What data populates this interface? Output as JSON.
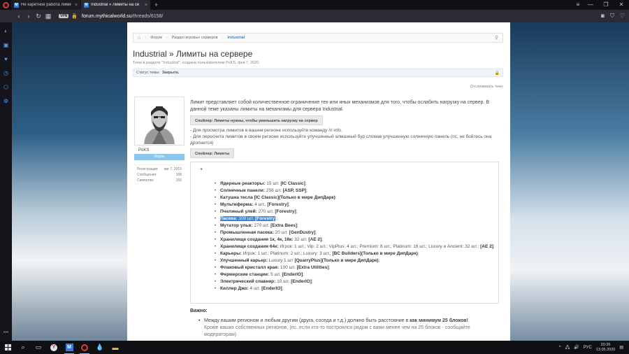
{
  "browser": {
    "tabs": [
      {
        "label": "Не каретное работа лими",
        "active": false
      },
      {
        "label": "Industrial » Лимиты на се",
        "active": true
      }
    ],
    "url_host": "forum.mythicalworld.su",
    "url_path": "/threads/6158/",
    "vpn_label": "VPN"
  },
  "breadcrumb": {
    "items": [
      "Форум",
      "Раздел игровых серверов",
      "Industrial"
    ]
  },
  "thread": {
    "title": "Industrial » Лимиты на сервере",
    "subtitle": "Тема в разделе \"Industrial\", создана пользователем PoKS, фев 7, 2020.",
    "status_label": "Статус темы:",
    "status_value": "Закрыта.",
    "watch_label": "Отслеживать тему"
  },
  "author": {
    "username": "PoKS",
    "role": "Игрок",
    "stats": [
      {
        "k": "Регистрация:",
        "v": "авг 7, 2015"
      },
      {
        "k": "Сообщения:",
        "v": "168"
      },
      {
        "k": "Симпатии:",
        "v": "155"
      }
    ]
  },
  "post": {
    "intro": "Лимит представляет собой количественное ограничение тех или иных механизмов для того, чтобы ослабить нагрузку на сервер. В данной теме указаны лимиты на механизмы для сервера Industrial.",
    "spoiler1": "Спойлер: Лимиты нужны, чтобы уменьшить нагрузку на сервер",
    "note1": "- Для просмотра лимитов в вашем регионе используйте команду /rl info.",
    "note2": "- Для пересчета лимитов в своем регионе используйте улучшенный алмазный бур сломав улучшенную солнечную панель (пс, не бойтесь она дропнется)",
    "spoiler2": "Спойлер: Лимиты",
    "limits": [
      {
        "name": "Ядерные реакторы:",
        "val": " 15 шт. ",
        "tag": "[IC Classic]",
        "end": ";"
      },
      {
        "name": "Солнечные панели:",
        "val": " 256 шт. ",
        "tag": "[ASP, SSP]",
        "end": ";"
      },
      {
        "name": "Катушка тесла [IC Classic](Только в мире ДипДарк)",
        "val": "",
        "tag": "",
        "end": ":"
      },
      {
        "name": "Мультиферма:",
        "val": " 4 шт., ",
        "tag": "[Forestry]",
        "end": ";"
      },
      {
        "name": "Пчелиный улей:",
        "val": " 270 шт. ",
        "tag": "[Forestry]",
        "end": ";"
      },
      {
        "name": "Пасека:",
        "val": " 100 шт. ",
        "tag": "[Forestry]",
        "end": ";",
        "highlight": true
      },
      {
        "name": "Мутатор ульв:",
        "val": " 270 шт. ",
        "tag": "[Extra Bees]",
        "end": ";"
      },
      {
        "name": "Промышленная пасека:",
        "val": " 20 шт. ",
        "tag": "[GenDustry]",
        "end": ";"
      },
      {
        "name": "Хранилище создания 1к, 4к, 16к:",
        "val": " 32 шт. ",
        "tag": "[AE 2]",
        "end": ";"
      },
      {
        "name": "Хранилище создания 64к:",
        "val": " Игрок: 1 шт.; Vip: 2 шт.; VipPlus: 4 шт.; Premium: 8 шт.; Platinum: 16 шт.; Luxury и Ancient: 32 шт.; ",
        "tag": "[AE 2]",
        "end": ";"
      },
      {
        "name": "Карьеры:",
        "val": " Игрок: 1 шт.; Platinum: 2 шт.; Luxury: 3 шт.; ",
        "tag": "[BC Builders](Только в мире ДипДарк)",
        "end": ";"
      },
      {
        "name": "Улучшенный карьер:",
        "val": " Luxury:1 шт ",
        "tag": "[QuarryPlus](Только в мире ДипДарк)",
        "end": ";"
      },
      {
        "name": "Флаковый кристалл края:",
        "val": " 100 шт. ",
        "tag": "[Extra Utilities]",
        "end": ";"
      },
      {
        "name": "Фермерские станции:",
        "val": " 5 шт. ",
        "tag": "[EnderIO]",
        "end": ";"
      },
      {
        "name": "Электрический спавнер:",
        "val": " 10 шт. ",
        "tag": "[EnderIO]",
        "end": ";"
      },
      {
        "name": "Киллер Джо:",
        "val": " 4 шт. ",
        "tag": "[EnderIO]",
        "end": ";"
      }
    ],
    "important_label": "Важно:",
    "important_1a": "Между вашим регионом и любым другим (друга, соседа и т.д.) должно быть расстояние в ",
    "important_1b": "как минимум 25 блоков!",
    "important_1c": "Кроме ваших собственных регионов, (пс. если кто-то построился рядом с вами менее чем на 25 блоков - сообщайте модераторам)"
  },
  "taskbar": {
    "lang": "РУС",
    "time": "20:26",
    "date": "13.05.2020"
  }
}
